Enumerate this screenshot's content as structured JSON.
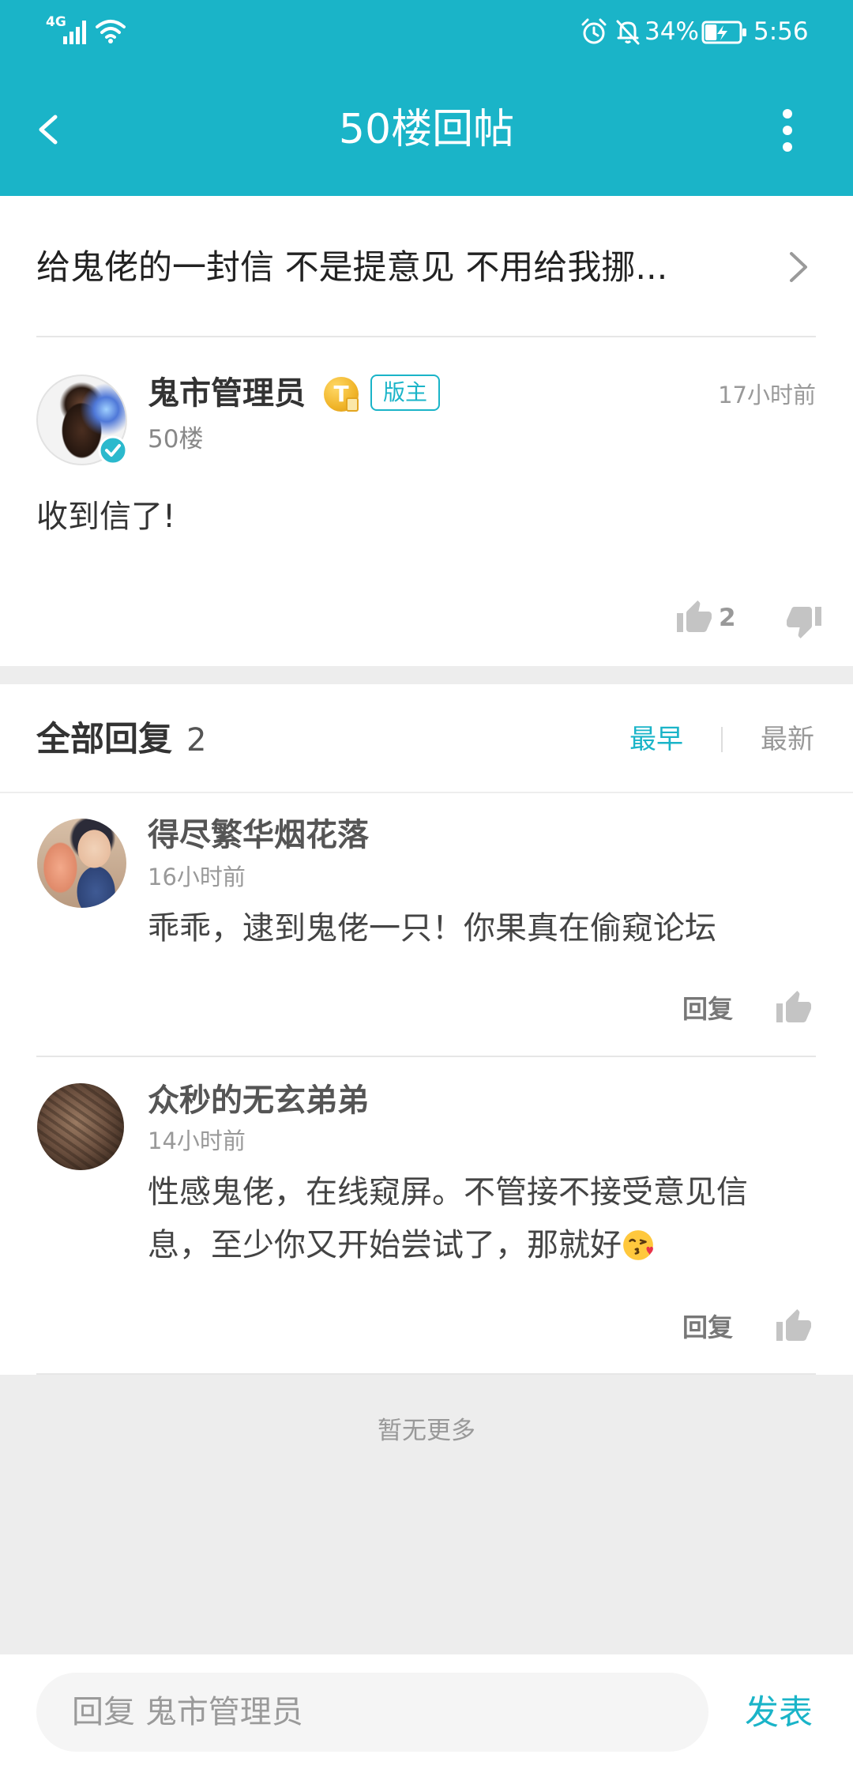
{
  "status_bar": {
    "network": "4G",
    "battery": "34%",
    "time": "5:56",
    "icons": [
      "signal-icon",
      "wifi-icon",
      "alarm-icon",
      "bell-off-icon",
      "battery-charging-icon"
    ],
    "battery_level": 0.34
  },
  "header": {
    "title": "50楼回帖",
    "back_icon": "chevron-left-icon",
    "more_icon": "more-vertical-icon"
  },
  "thread": {
    "title": "给鬼佬的一封信 不是提意见 不用给我挪...",
    "chevron_icon": "chevron-right-icon"
  },
  "post": {
    "author": "鬼市管理员",
    "level_badge": "T",
    "role_badge": "版主",
    "time": "17小时前",
    "floor": "50楼",
    "content": "收到信了!",
    "likes": "2",
    "verified_icon": "verified-check-icon"
  },
  "replies_section": {
    "title": "全部回复",
    "count": "2",
    "sort_earliest": "最早",
    "sort_latest": "最新",
    "active_sort": "最早"
  },
  "replies": [
    {
      "author": "得尽繁华烟花落",
      "time": "16小时前",
      "content": "乖乖，逮到鬼佬一只！你果真在偷窥论坛",
      "reply_label": "回复"
    },
    {
      "author": "众秒的无玄弟弟",
      "time": "14小时前",
      "content": "性感鬼佬，在线窥屏。不管接不接受意见信息，至少你又开始尝试了，那就好",
      "emoji_icon": "face-blowing-a-kiss-icon",
      "reply_label": "回复"
    }
  ],
  "footer_note": "暂无更多",
  "composer": {
    "placeholder": "回复 鬼市管理员",
    "submit_label": "发表"
  },
  "colors": {
    "accent": "#1ab4c8",
    "background_gray": "#ededed",
    "icon_gray": "#c4c4c4",
    "level_badge_gold": "#f0b429"
  }
}
